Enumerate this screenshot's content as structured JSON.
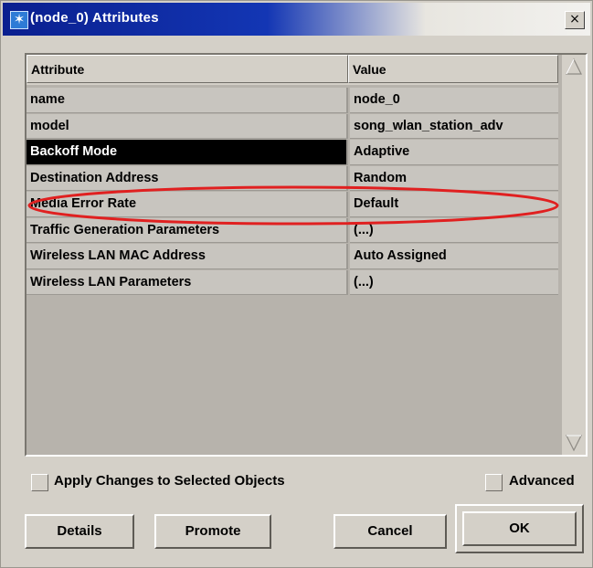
{
  "window": {
    "title": "(node_0) Attributes",
    "close_label": "×"
  },
  "table": {
    "header_attribute": "Attribute",
    "header_value": "Value",
    "rows": [
      {
        "attribute": "name",
        "value": "node_0"
      },
      {
        "attribute": "model",
        "value": "song_wlan_station_adv"
      },
      {
        "attribute": "Backoff Mode",
        "value": "Adaptive",
        "selected": true
      },
      {
        "attribute": "Destination Address",
        "value": "Random"
      },
      {
        "attribute": "Media Error Rate",
        "value": "Default"
      },
      {
        "attribute": "Traffic Generation Parameters",
        "value": "(...)"
      },
      {
        "attribute": "Wireless LAN MAC Address",
        "value": "Auto Assigned"
      },
      {
        "attribute": "Wireless LAN Parameters",
        "value": "(...)"
      }
    ],
    "highlight_color": "#e02020"
  },
  "options": {
    "apply_changes_label": "Apply Changes to Selected Objects",
    "advanced_label": "Advanced"
  },
  "buttons": {
    "details": "Details",
    "promote": "Promote",
    "cancel": "Cancel",
    "ok": "OK"
  },
  "colors": {
    "dialog_bg": "#d4d0c8",
    "title_bar": "#0a1f8f",
    "selected_row_bg": "#000000"
  }
}
